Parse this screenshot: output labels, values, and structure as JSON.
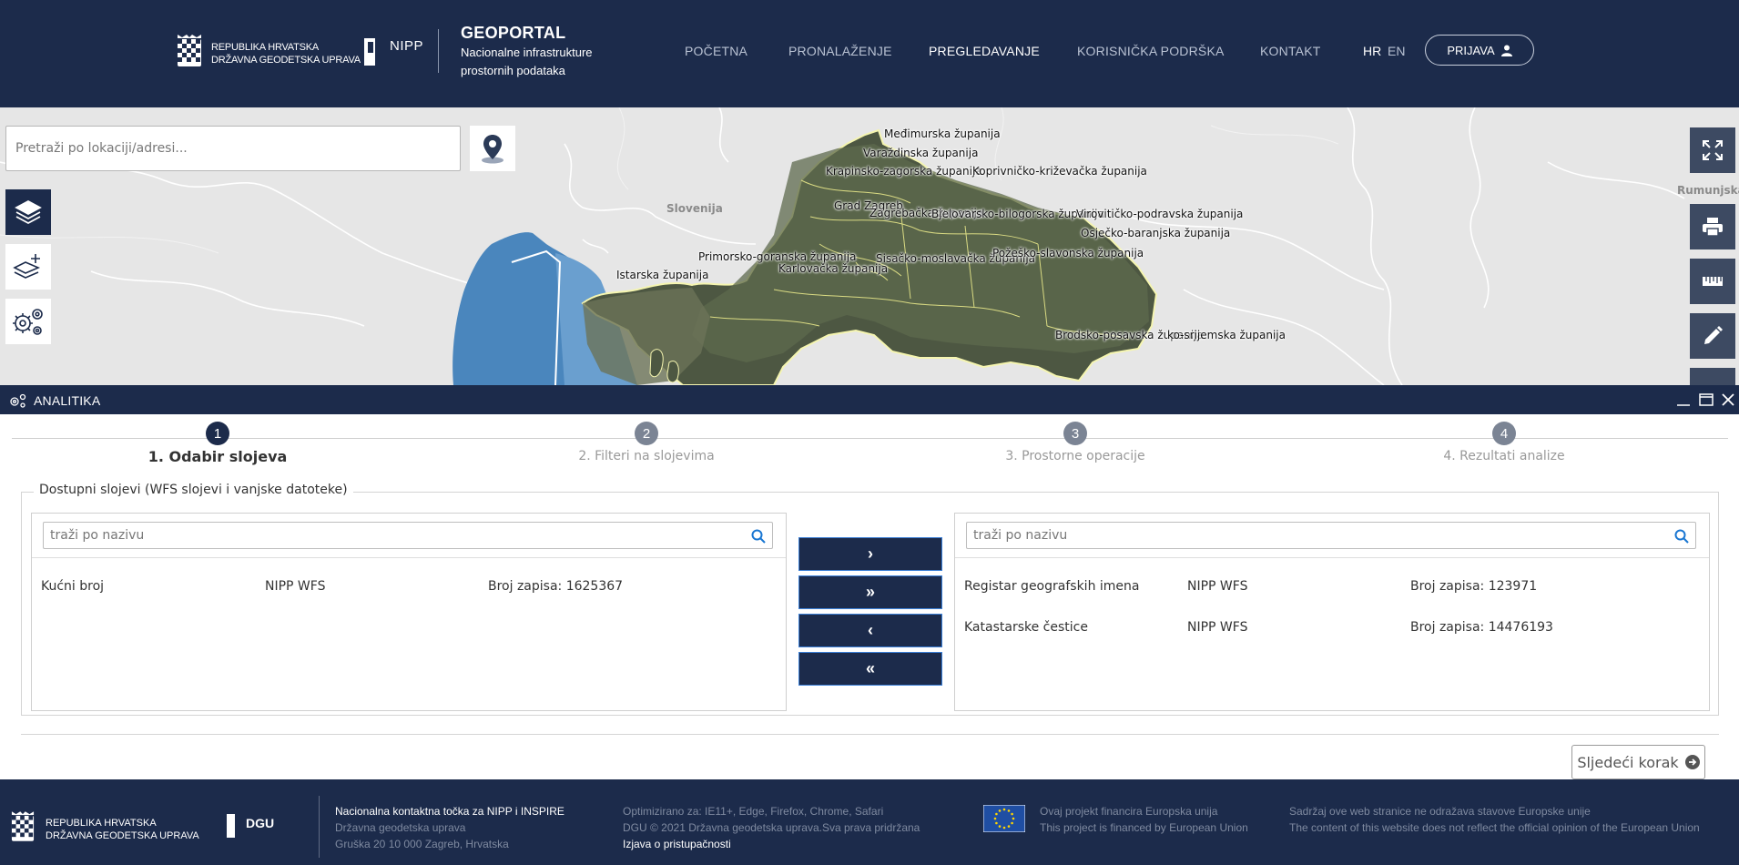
{
  "header": {
    "org_line1": "REPUBLIKA HRVATSKA",
    "org_line2": "DRŽAVNA GEODETSKA UPRAVA",
    "nipp_logo": "NIPP",
    "title": "GEOPORTAL",
    "subtitle_line1": "Nacionalne infrastrukture",
    "subtitle_line2": "prostornih podataka",
    "nav": [
      "POČETNA",
      "PRONALAŽENJE",
      "PREGLEDAVANJE",
      "KORISNIČKA PODRŠKA",
      "KONTAKT"
    ],
    "active_nav": "PREGLEDAVANJE",
    "lang_hr": "HR",
    "lang_en": "EN",
    "login_label": "PRIJAVA"
  },
  "map": {
    "search_placeholder": "Pretraži po lokaciji/adresi...",
    "countries": {
      "slovenia": "Slovenija",
      "romania": "Rumunjska"
    },
    "region_labels": [
      "Međimurska županija",
      "Varaždinska županija",
      "Krapinsko-zagorska županija",
      "Koprivničko-križevačka županija",
      "Grad Zagreb",
      "Zagrebačka županija",
      "Bjelovarsko-bilogorska županija",
      "Virovitičko-podravska županija",
      "Osječko-baranjska županija",
      "Primorsko-goranska županija",
      "Karlovačka županija",
      "Sisačko-moslavačka županija",
      "Požeško-slavonska županija",
      "Istarska županija",
      "Brodsko-posavska županija",
      "Vukovarsko-srijemska županija"
    ]
  },
  "panel": {
    "title": "ANALITIKA",
    "steps": [
      {
        "number": "1",
        "label": "1. Odabir slojeva"
      },
      {
        "number": "2",
        "label": "2. Filteri na slojevima"
      },
      {
        "number": "3",
        "label": "3. Prostorne operacije"
      },
      {
        "number": "4",
        "label": "4. Rezultati analize"
      }
    ],
    "active_step": 1,
    "fieldset_legend": "Dostupni slojevi (WFS slojevi i vanjske datoteke)",
    "left_list": {
      "search_placeholder": "traži po nazivu",
      "rows": [
        {
          "name": "Kućni broj",
          "source": "NIPP WFS",
          "count": "Broj zapisa: 1625367"
        }
      ]
    },
    "right_list": {
      "search_placeholder": "traži po nazivu",
      "rows": [
        {
          "name": "Registar geografskih imena",
          "source": "NIPP WFS",
          "count": "Broj zapisa: 123971"
        },
        {
          "name": "Katastarske čestice",
          "source": "NIPP WFS",
          "count": "Broj zapisa: 14476193"
        }
      ]
    },
    "move_buttons": {
      "add_one": "›",
      "add_all": "»",
      "remove_one": "‹",
      "remove_all": "«"
    },
    "next_label": "Sljedeći korak"
  },
  "footer": {
    "org_line1": "REPUBLIKA HRVATSKA",
    "org_line2": "DRŽAVNA GEODETSKA UPRAVA",
    "dgu_logo": "DGU",
    "contact_title": "Nacionalna kontaktna točka za NIPP i INSPIRE",
    "contact_org": "Državna geodetska uprava",
    "contact_address": "Gruška 20 10 000 Zagreb, Hrvatska",
    "optimized": "Optimizirano za: IE11+, Edge, Firefox, Chrome, Safari",
    "copyright": "DGU © 2021 Državna geodetska uprava.Sva prava pridržana",
    "accessibility": "Izjava o pristupačnosti",
    "eu_hr": "Ovaj projekt financira Europska unija",
    "eu_en": "This project is financed by European Union",
    "disclaimer_hr": "Sadržaj ove web stranice ne odražava stavove Europske unije",
    "disclaimer_en": "The content of this website does not reflect the official opinion of the European Union"
  },
  "colors": {
    "navy": "#1c2b4b",
    "sea": "#4a86bd",
    "map_bg": "#e6e6e6",
    "step_inactive": "#7b8494",
    "accent_blue": "#1976d2"
  },
  "icons": [
    "coat-of-arms-icon",
    "location-pin-icon",
    "layers-icon",
    "add-layer-icon",
    "settings-icon",
    "fullscreen-icon",
    "print-icon",
    "ruler-icon",
    "pencil-icon",
    "search-icon",
    "user-icon",
    "minimize-icon",
    "maximize-icon",
    "close-icon",
    "arrow-right-circle-icon",
    "eu-flag-icon"
  ]
}
